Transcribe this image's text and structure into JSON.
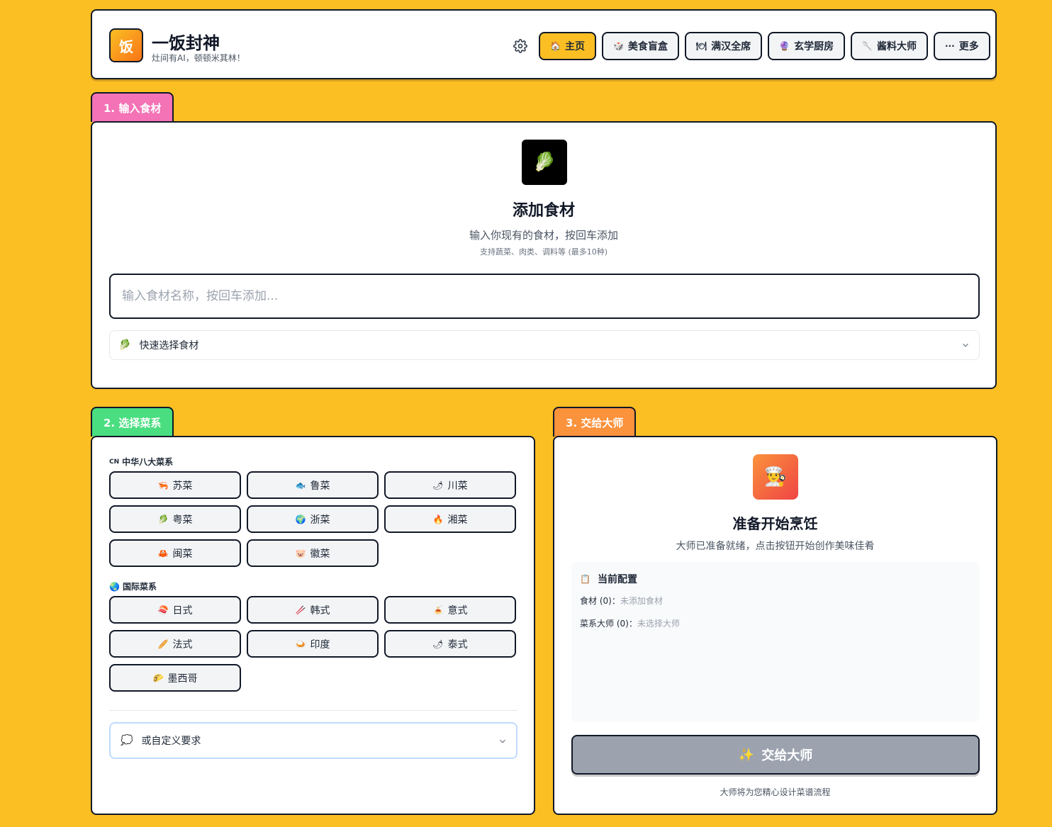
{
  "header": {
    "logo_char": "饭",
    "title": "一饭封神",
    "subtitle": "灶间有AI，顿顿米其林！",
    "nav": [
      {
        "icon": "🏠",
        "label": "主页",
        "active": true
      },
      {
        "icon": "🎲",
        "label": "美食盲盒"
      },
      {
        "icon": "🍽",
        "label": "满汉全席"
      },
      {
        "icon": "🔮",
        "label": "玄学厨房"
      },
      {
        "icon": "🥄",
        "label": "酱料大师"
      },
      {
        "icon": "···",
        "label": "更多"
      }
    ]
  },
  "section1": {
    "tab": "1. 输入食材",
    "tab_color": "#f472b6",
    "icon": "🥬",
    "title": "添加食材",
    "subtitle": "输入你现有的食材，按回车添加",
    "hint": "支持蔬菜、肉类、调料等 (最多10种)",
    "input_placeholder": "输入食材名称，按回车添加...",
    "quick_select_icon": "🥬",
    "quick_select_label": "快速选择食材"
  },
  "section2": {
    "tab": "2. 选择菜系",
    "tab_color": "#4ade80",
    "chinese_label_icon": "CN",
    "chinese_label": "中华八大菜系",
    "chinese": [
      {
        "icon": "🦐",
        "label": "苏菜"
      },
      {
        "icon": "🐟",
        "label": "鲁菜"
      },
      {
        "icon": "🌶",
        "label": "川菜"
      },
      {
        "icon": "🥬",
        "label": "粤菜"
      },
      {
        "icon": "🌍",
        "label": "浙菜"
      },
      {
        "icon": "🔥",
        "label": "湘菜"
      },
      {
        "icon": "🦀",
        "label": "闽菜"
      },
      {
        "icon": "🐷",
        "label": "徽菜"
      }
    ],
    "intl_label_icon": "🌏",
    "intl_label": "国际菜系",
    "international": [
      {
        "icon": "🍣",
        "label": "日式"
      },
      {
        "icon": "🥢",
        "label": "韩式"
      },
      {
        "icon": "🍝",
        "label": "意式"
      },
      {
        "icon": "🥖",
        "label": "法式"
      },
      {
        "icon": "🍛",
        "label": "印度"
      },
      {
        "icon": "🌶",
        "label": "泰式"
      },
      {
        "icon": "🌮",
        "label": "墨西哥"
      }
    ],
    "custom_icon": "💭",
    "custom_label": "或自定义要求"
  },
  "section3": {
    "tab": "3. 交给大师",
    "tab_color": "#fb923c",
    "icon": "👨‍🍳",
    "title": "准备开始烹饪",
    "subtitle": "大师已准备就绪，点击按钮开始创作美味佳肴",
    "config_icon": "📋",
    "config_title": "当前配置",
    "ingredients_label": "食材 (0)：",
    "ingredients_value": "未添加食材",
    "masters_label": "菜系大师 (0)：",
    "masters_value": "未选择大师",
    "submit_icon": "✨",
    "submit_label": "交给大师",
    "footer": "大师将为您精心设计菜谱流程"
  }
}
